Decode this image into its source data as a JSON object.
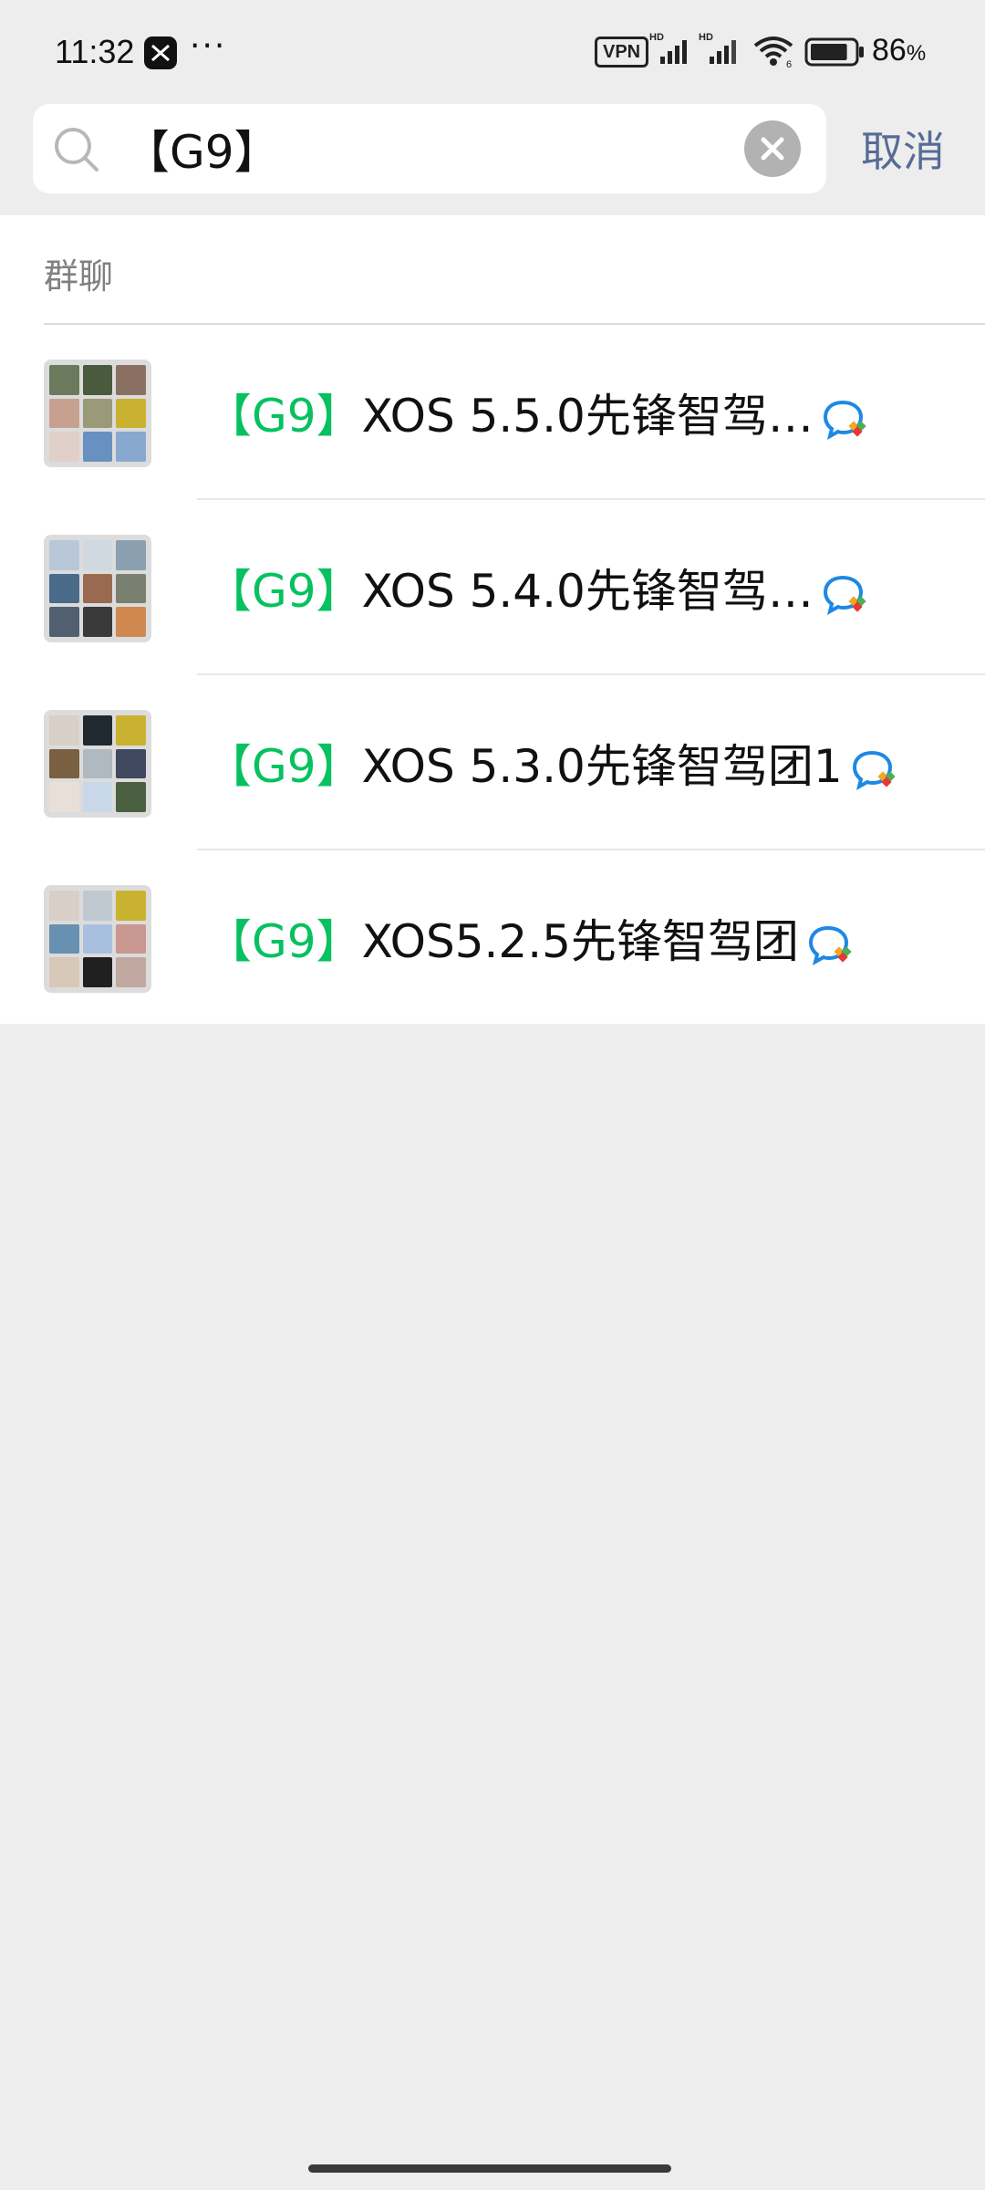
{
  "status_bar": {
    "time": "11:32",
    "more": "···",
    "vpn": "VPN",
    "battery_percent": "86",
    "battery_unit": "%",
    "battery_level": 0.86,
    "icons": [
      "app-icon",
      "signal-hd-icon",
      "signal-hd-icon",
      "wifi-icon",
      "battery-icon"
    ]
  },
  "search": {
    "value": "【G9】",
    "cancel_label": "取消"
  },
  "results": {
    "section_title": "群聊",
    "items": [
      {
        "tag": "【G9】",
        "name": "XOS 5.5.0先锋智驾…"
      },
      {
        "tag": "【G9】",
        "name": "XOS 5.4.0先锋智驾…"
      },
      {
        "tag": "【G9】",
        "name": "XOS 5.3.0先锋智驾团1"
      },
      {
        "tag": "【G9】",
        "name": "XOS5.2.5先锋智驾团"
      }
    ]
  },
  "colors": {
    "highlight": "#07c160",
    "link": "#576b95",
    "background": "#ededed"
  }
}
